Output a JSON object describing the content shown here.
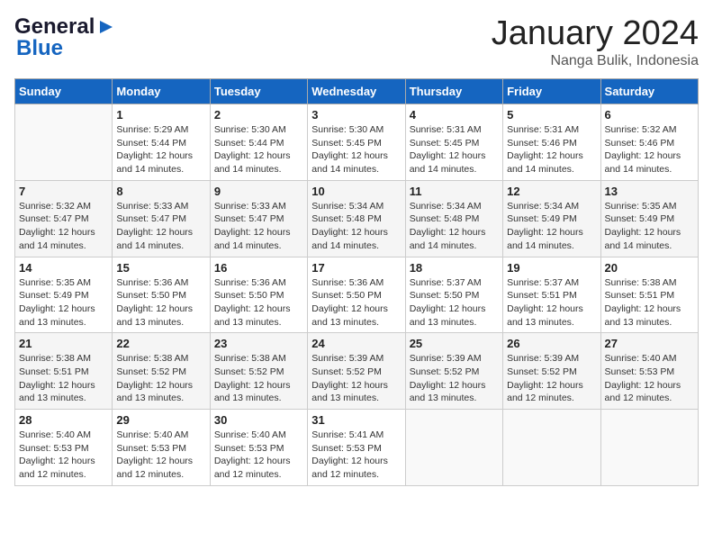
{
  "logo": {
    "line1": "General",
    "line2": "Blue"
  },
  "header": {
    "month": "January 2024",
    "location": "Nanga Bulik, Indonesia"
  },
  "columns": [
    "Sunday",
    "Monday",
    "Tuesday",
    "Wednesday",
    "Thursday",
    "Friday",
    "Saturday"
  ],
  "weeks": [
    [
      {
        "day": "",
        "info": ""
      },
      {
        "day": "1",
        "info": "Sunrise: 5:29 AM\nSunset: 5:44 PM\nDaylight: 12 hours\nand 14 minutes."
      },
      {
        "day": "2",
        "info": "Sunrise: 5:30 AM\nSunset: 5:44 PM\nDaylight: 12 hours\nand 14 minutes."
      },
      {
        "day": "3",
        "info": "Sunrise: 5:30 AM\nSunset: 5:45 PM\nDaylight: 12 hours\nand 14 minutes."
      },
      {
        "day": "4",
        "info": "Sunrise: 5:31 AM\nSunset: 5:45 PM\nDaylight: 12 hours\nand 14 minutes."
      },
      {
        "day": "5",
        "info": "Sunrise: 5:31 AM\nSunset: 5:46 PM\nDaylight: 12 hours\nand 14 minutes."
      },
      {
        "day": "6",
        "info": "Sunrise: 5:32 AM\nSunset: 5:46 PM\nDaylight: 12 hours\nand 14 minutes."
      }
    ],
    [
      {
        "day": "7",
        "info": "Sunrise: 5:32 AM\nSunset: 5:47 PM\nDaylight: 12 hours\nand 14 minutes."
      },
      {
        "day": "8",
        "info": "Sunrise: 5:33 AM\nSunset: 5:47 PM\nDaylight: 12 hours\nand 14 minutes."
      },
      {
        "day": "9",
        "info": "Sunrise: 5:33 AM\nSunset: 5:47 PM\nDaylight: 12 hours\nand 14 minutes."
      },
      {
        "day": "10",
        "info": "Sunrise: 5:34 AM\nSunset: 5:48 PM\nDaylight: 12 hours\nand 14 minutes."
      },
      {
        "day": "11",
        "info": "Sunrise: 5:34 AM\nSunset: 5:48 PM\nDaylight: 12 hours\nand 14 minutes."
      },
      {
        "day": "12",
        "info": "Sunrise: 5:34 AM\nSunset: 5:49 PM\nDaylight: 12 hours\nand 14 minutes."
      },
      {
        "day": "13",
        "info": "Sunrise: 5:35 AM\nSunset: 5:49 PM\nDaylight: 12 hours\nand 14 minutes."
      }
    ],
    [
      {
        "day": "14",
        "info": "Sunrise: 5:35 AM\nSunset: 5:49 PM\nDaylight: 12 hours\nand 13 minutes."
      },
      {
        "day": "15",
        "info": "Sunrise: 5:36 AM\nSunset: 5:50 PM\nDaylight: 12 hours\nand 13 minutes."
      },
      {
        "day": "16",
        "info": "Sunrise: 5:36 AM\nSunset: 5:50 PM\nDaylight: 12 hours\nand 13 minutes."
      },
      {
        "day": "17",
        "info": "Sunrise: 5:36 AM\nSunset: 5:50 PM\nDaylight: 12 hours\nand 13 minutes."
      },
      {
        "day": "18",
        "info": "Sunrise: 5:37 AM\nSunset: 5:50 PM\nDaylight: 12 hours\nand 13 minutes."
      },
      {
        "day": "19",
        "info": "Sunrise: 5:37 AM\nSunset: 5:51 PM\nDaylight: 12 hours\nand 13 minutes."
      },
      {
        "day": "20",
        "info": "Sunrise: 5:38 AM\nSunset: 5:51 PM\nDaylight: 12 hours\nand 13 minutes."
      }
    ],
    [
      {
        "day": "21",
        "info": "Sunrise: 5:38 AM\nSunset: 5:51 PM\nDaylight: 12 hours\nand 13 minutes."
      },
      {
        "day": "22",
        "info": "Sunrise: 5:38 AM\nSunset: 5:52 PM\nDaylight: 12 hours\nand 13 minutes."
      },
      {
        "day": "23",
        "info": "Sunrise: 5:38 AM\nSunset: 5:52 PM\nDaylight: 12 hours\nand 13 minutes."
      },
      {
        "day": "24",
        "info": "Sunrise: 5:39 AM\nSunset: 5:52 PM\nDaylight: 12 hours\nand 13 minutes."
      },
      {
        "day": "25",
        "info": "Sunrise: 5:39 AM\nSunset: 5:52 PM\nDaylight: 12 hours\nand 13 minutes."
      },
      {
        "day": "26",
        "info": "Sunrise: 5:39 AM\nSunset: 5:52 PM\nDaylight: 12 hours\nand 12 minutes."
      },
      {
        "day": "27",
        "info": "Sunrise: 5:40 AM\nSunset: 5:53 PM\nDaylight: 12 hours\nand 12 minutes."
      }
    ],
    [
      {
        "day": "28",
        "info": "Sunrise: 5:40 AM\nSunset: 5:53 PM\nDaylight: 12 hours\nand 12 minutes."
      },
      {
        "day": "29",
        "info": "Sunrise: 5:40 AM\nSunset: 5:53 PM\nDaylight: 12 hours\nand 12 minutes."
      },
      {
        "day": "30",
        "info": "Sunrise: 5:40 AM\nSunset: 5:53 PM\nDaylight: 12 hours\nand 12 minutes."
      },
      {
        "day": "31",
        "info": "Sunrise: 5:41 AM\nSunset: 5:53 PM\nDaylight: 12 hours\nand 12 minutes."
      },
      {
        "day": "",
        "info": ""
      },
      {
        "day": "",
        "info": ""
      },
      {
        "day": "",
        "info": ""
      }
    ]
  ]
}
